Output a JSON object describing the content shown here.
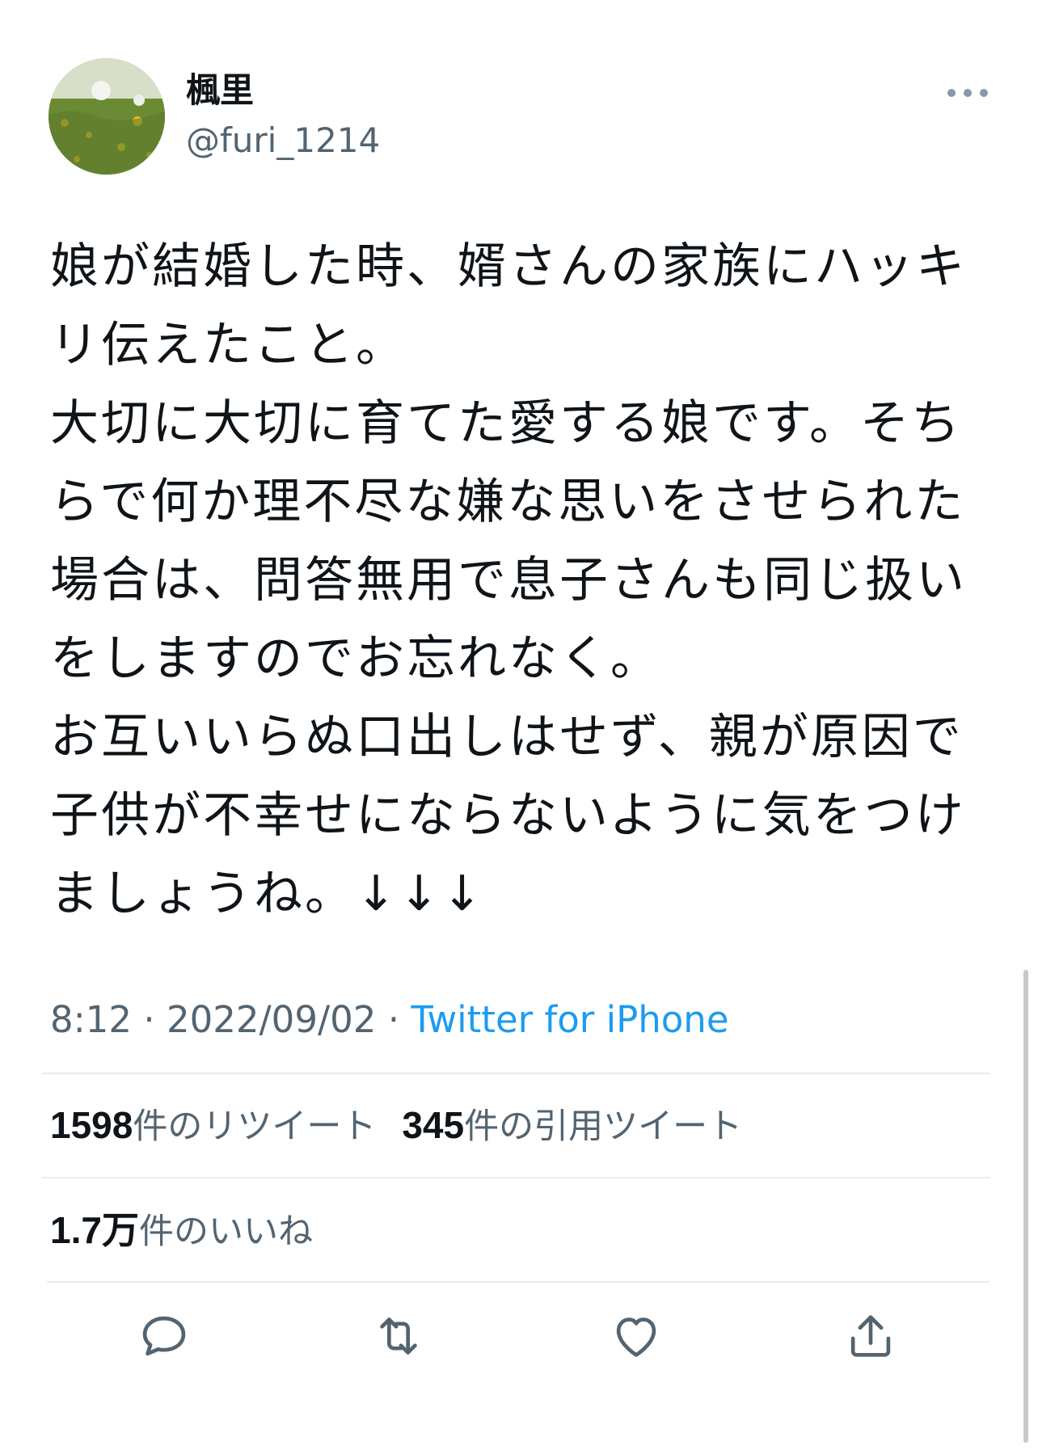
{
  "user": {
    "display_name": "楓里",
    "handle": "@furi_1214"
  },
  "tweet": {
    "text": "娘が結婚した時、婿さんの家族にハッキリ伝えたこと。\n大切に大切に育てた愛する娘です。そちらで何か理不尽な嫌な思いをさせられた場合は、問答無用で息子さんも同じ扱いをしますのでお忘れなく。\nお互いいらぬ口出しはせず、親が原因で子供が不幸せにならないように気をつけましょうね。↓↓↓",
    "time": "8:12",
    "date": "2022/09/02",
    "separator": "·",
    "source": "Twitter for iPhone"
  },
  "stats": {
    "retweets_count": "1598",
    "retweets_label": "件のリツイート",
    "quotes_count": "345",
    "quotes_label": "件の引用ツイート",
    "likes_count": "1.7万",
    "likes_label": "件のいいね"
  },
  "colors": {
    "text": "#0f1419",
    "secondary": "#536471",
    "link": "#1d9bf0",
    "divider": "#e6ecf0"
  },
  "icons": {
    "more": "more-horizontal-icon",
    "reply": "reply-icon",
    "retweet": "retweet-icon",
    "like": "heart-icon",
    "share": "share-icon"
  }
}
